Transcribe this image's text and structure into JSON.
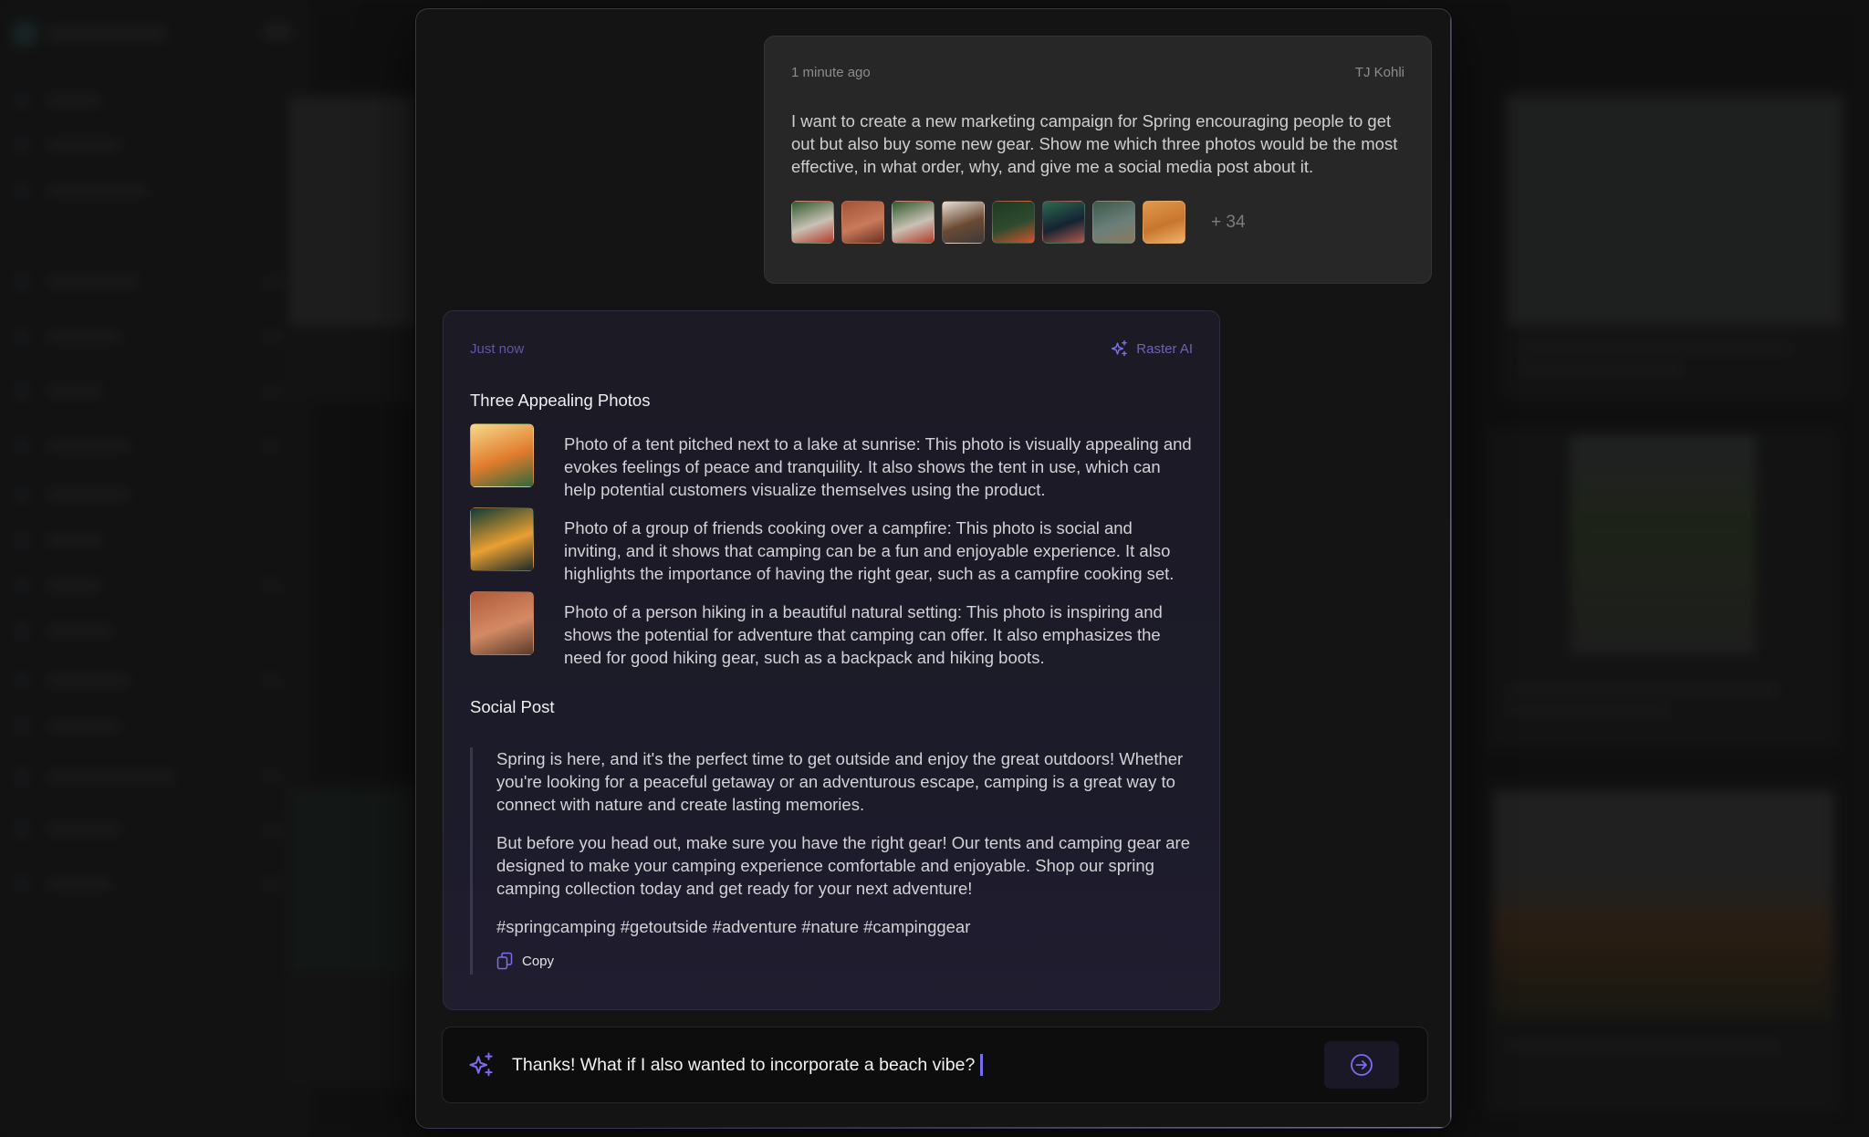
{
  "user_message": {
    "timestamp": "1 minute ago",
    "author": "TJ Kohli",
    "text": "I want to create a new marketing campaign for Spring encouraging people to get out but also buy some new gear. Show me which three photos would be the most effective, in what order, why, and give me a social media post about it.",
    "attachments": [
      {
        "icon": "tent-forest-photo",
        "colors": [
          "#2f5a2c",
          "#c9c1b5",
          "#b33a2a"
        ]
      },
      {
        "icon": "canyon-hiker-photo",
        "colors": [
          "#a35237",
          "#c97a5a",
          "#6b2f22"
        ]
      },
      {
        "icon": "tent-forest-photo",
        "colors": [
          "#2f5a2c",
          "#c9c1b5",
          "#b33a2a"
        ]
      },
      {
        "icon": "coffee-table-photo",
        "colors": [
          "#e8e0d6",
          "#6b4a33",
          "#3a3a3a"
        ]
      },
      {
        "icon": "forest-tent-photo",
        "colors": [
          "#1e3a24",
          "#2e4b2e",
          "#d2542e"
        ]
      },
      {
        "icon": "mug-logo-photo",
        "colors": [
          "#2d6a50",
          "#152332",
          "#b45a4a"
        ]
      },
      {
        "icon": "campsite-man-photo",
        "colors": [
          "#3c5a4a",
          "#6b7f7a",
          "#8a7a5a"
        ]
      },
      {
        "icon": "texture-orange-photo",
        "colors": [
          "#e09a4e",
          "#c8762e",
          "#f0b46a"
        ]
      }
    ],
    "more_count": "+ 34"
  },
  "ai_message": {
    "timestamp": "Just now",
    "author": "Raster AI",
    "accent": "#7b6cf0",
    "photos_section": {
      "title": "Three Appealing Photos",
      "items": [
        {
          "thumb": "tent-lake-sunrise-photo",
          "colors": [
            "#f6d98a",
            "#e07b2c",
            "#2f6a3a"
          ],
          "text": "Photo of a tent pitched next to a lake at sunrise: This photo is visually appealing and evokes feelings of peace and tranquility. It also shows the tent in use, which can help potential customers visualize themselves using the product."
        },
        {
          "thumb": "campfire-friends-photo",
          "colors": [
            "#0f3a34",
            "#e9a032",
            "#1d2a2a"
          ],
          "text": "Photo of a group of friends cooking over a campfire: This photo is social and inviting, and it shows that camping can be a fun and enjoyable experience. It also highlights the importance of having the right gear, such as a campfire cooking set."
        },
        {
          "thumb": "person-hiking-photo",
          "colors": [
            "#b05a3a",
            "#d48a64",
            "#5a3a2a"
          ],
          "text": "Photo of a person hiking in a beautiful natural setting: This photo is inspiring and shows the potential for adventure that camping can offer. It also emphasizes the need for good hiking gear, such as a backpack and hiking boots."
        }
      ]
    },
    "social_section": {
      "title": "Social Post",
      "paragraphs": [
        "Spring is here, and it's the perfect time to get outside and enjoy the great outdoors! Whether you're looking for a peaceful getaway or an adventurous escape, camping is a great way to connect with nature and create lasting memories.",
        "But before you head out, make sure you have the right gear! Our tents and camping gear are designed to make your camping experience comfortable and enjoyable. Shop our spring camping collection today and get ready for your next adventure!",
        "#springcamping #getoutside #adventure #nature #campinggear"
      ],
      "copy_label": "Copy"
    }
  },
  "input": {
    "value": "Thanks! What if I also wanted to incorporate a beach vibe?",
    "send_icon": "arrow-right-circle-icon",
    "leading_icon": "sparkles-icon"
  }
}
